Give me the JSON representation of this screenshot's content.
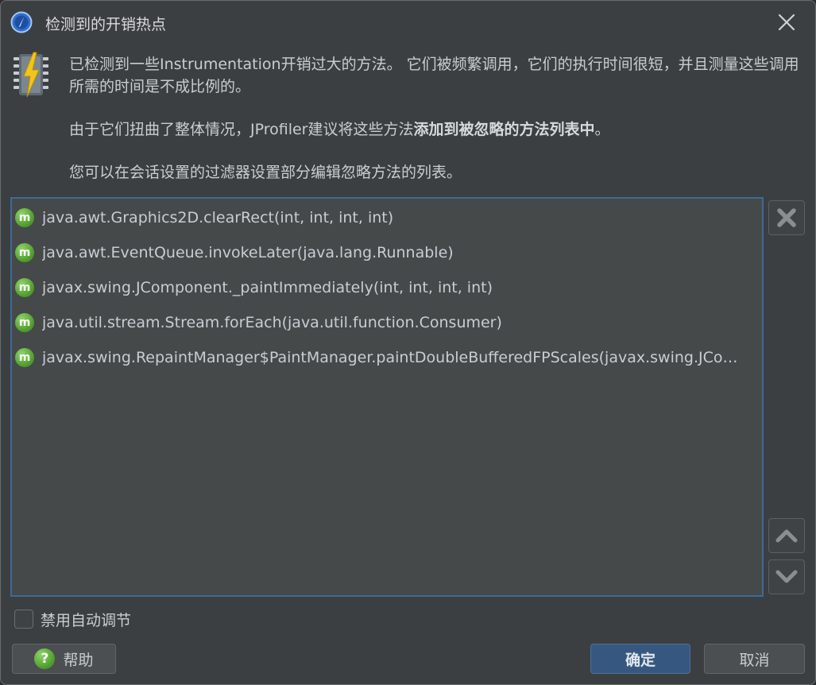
{
  "window": {
    "title": "检测到的开销热点",
    "close_icon": "close-icon",
    "app_icon": "jprofiler-app-icon"
  },
  "message": {
    "icon": "chip-lightning-icon",
    "para1": "已检测到一些Instrumentation开销过大的方法。 它们被频繁调用，它们的执行时间很短，并且测量这些调用所需的时间是不成比例的。",
    "para2_prefix": "由于它们扭曲了整体情况，JProfiler建议将这些方法",
    "para2_bold": "添加到被忽略的方法列表中",
    "para2_suffix": "。",
    "para3": "您可以在会话设置的过滤器设置部分编辑忽略方法的列表。"
  },
  "methods": {
    "icon_letter": "m",
    "items": [
      "java.awt.Graphics2D.clearRect(int, int, int, int)",
      "java.awt.EventQueue.invokeLater(java.lang.Runnable)",
      "javax.swing.JComponent._paintImmediately(int, int, int, int)",
      "java.util.stream.Stream.forEach(java.util.function.Consumer)",
      "javax.swing.RepaintManager$PaintManager.paintDoubleBufferedFPScales(javax.swing.JCompo…"
    ]
  },
  "side_buttons": {
    "remove_icon": "remove-x-icon",
    "up_icon": "move-up-icon",
    "down_icon": "move-down-icon"
  },
  "options": {
    "disable_auto_tuning": "禁用自动调节",
    "checked": false
  },
  "buttons": {
    "help": "帮助",
    "help_icon": "?",
    "ok": "确定",
    "cancel": "取消"
  },
  "colors": {
    "background": "#3c3f41",
    "list_background": "#45494a",
    "list_border": "#3d6a96",
    "primary_button": "#365880",
    "method_icon": "#5aa832"
  }
}
